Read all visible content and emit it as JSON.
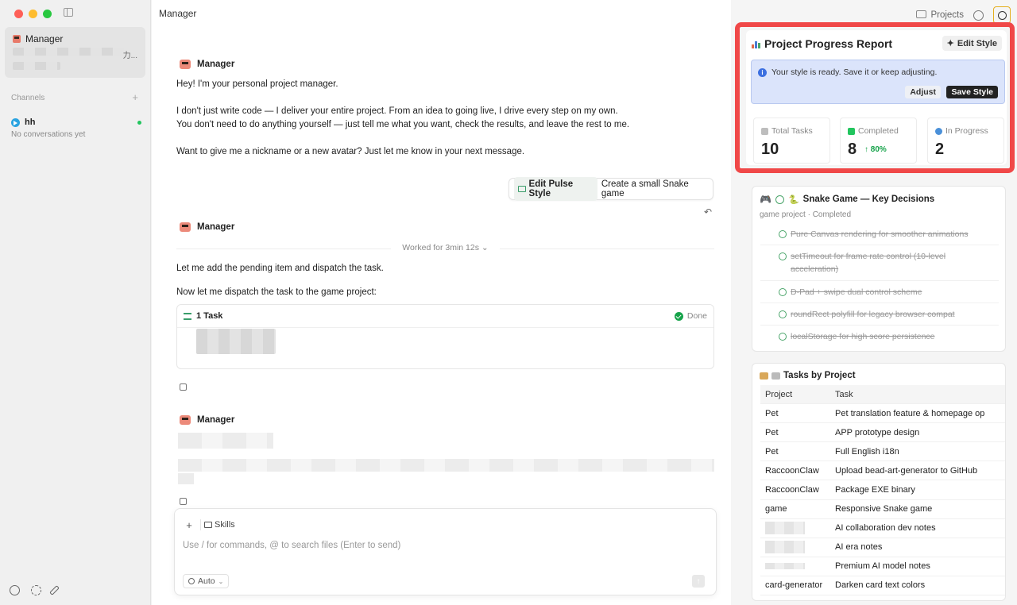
{
  "sidebar": {
    "conversation": {
      "title": "Manager",
      "fragment": "力..."
    },
    "channels_label": "Channels",
    "channels_add": "+",
    "channel": {
      "name": "hh",
      "subtitle": "No conversations yet"
    }
  },
  "main": {
    "title": "Manager",
    "msg1": {
      "author": "Manager",
      "line1": "Hey! I'm your personal project manager.",
      "line2": "I don't just write code — I deliver your entire project. From an idea to going live, I drive every step on my own.",
      "line3": "You don't need to do anything yourself — just tell me what you want, check the results, and leave the rest to me.",
      "line4": "Want to give me a nickname or a new avatar? Just let me know in your next message."
    },
    "user_msg": {
      "tag": "Edit Pulse Style",
      "text": "Create a small Snake game"
    },
    "msg2": {
      "author": "Manager",
      "worked": "Worked for 3min 12s ⌄",
      "line1": "Let me add the pending item and dispatch the task.",
      "line2": "Now let me dispatch the task to the game project:",
      "task_title": "1 Task",
      "task_status": "Done"
    },
    "msg3": {
      "author": "Manager"
    },
    "composer": {
      "plus": "+",
      "skills": "Skills",
      "placeholder": "Use / for commands, @ to search files (Enter to send)",
      "mode": "Auto",
      "send": "↑"
    }
  },
  "right": {
    "projects_label": "Projects",
    "report": {
      "title": "Project Progress Report",
      "edit_style": "Edit Style",
      "notice": "Your style is ready. Save it or keep adjusting.",
      "adjust": "Adjust",
      "save": "Save Style",
      "stats": [
        {
          "label": "Total Tasks",
          "value": "10",
          "color": "#bdbdbd"
        },
        {
          "label": "Completed",
          "value": "8",
          "delta": "↑ 80%",
          "color": "#22c55e"
        },
        {
          "label": "In Progress",
          "value": "2",
          "color": "#4a90d9"
        }
      ]
    },
    "snake": {
      "title": "Snake Game — Key Decisions",
      "subtitle": "game project · Completed",
      "decisions": [
        "Pure Canvas rendering for smoother animations",
        "setTimeout for frame rate control (10-level acceleration)",
        "D-Pad + swipe dual control scheme",
        "roundRect polyfill for legacy browser compat",
        "localStorage for high score persistence"
      ]
    },
    "tasks_by_project": {
      "title": "Tasks by Project",
      "headers": [
        "Project",
        "Task"
      ],
      "rows": [
        [
          "Pet",
          "Pet translation feature & homepage op"
        ],
        [
          "Pet",
          "APP prototype design"
        ],
        [
          "Pet",
          "Full English i18n"
        ],
        [
          "RaccoonClaw",
          "Upload bead-art-generator to GitHub"
        ],
        [
          "RaccoonClaw",
          "Package EXE binary"
        ],
        [
          "game",
          "Responsive Snake game"
        ],
        [
          "",
          "AI collaboration dev notes"
        ],
        [
          "",
          "AI era notes"
        ],
        [
          "",
          "Premium AI model notes"
        ],
        [
          "card-generator",
          "Darken card text colors"
        ]
      ]
    }
  }
}
